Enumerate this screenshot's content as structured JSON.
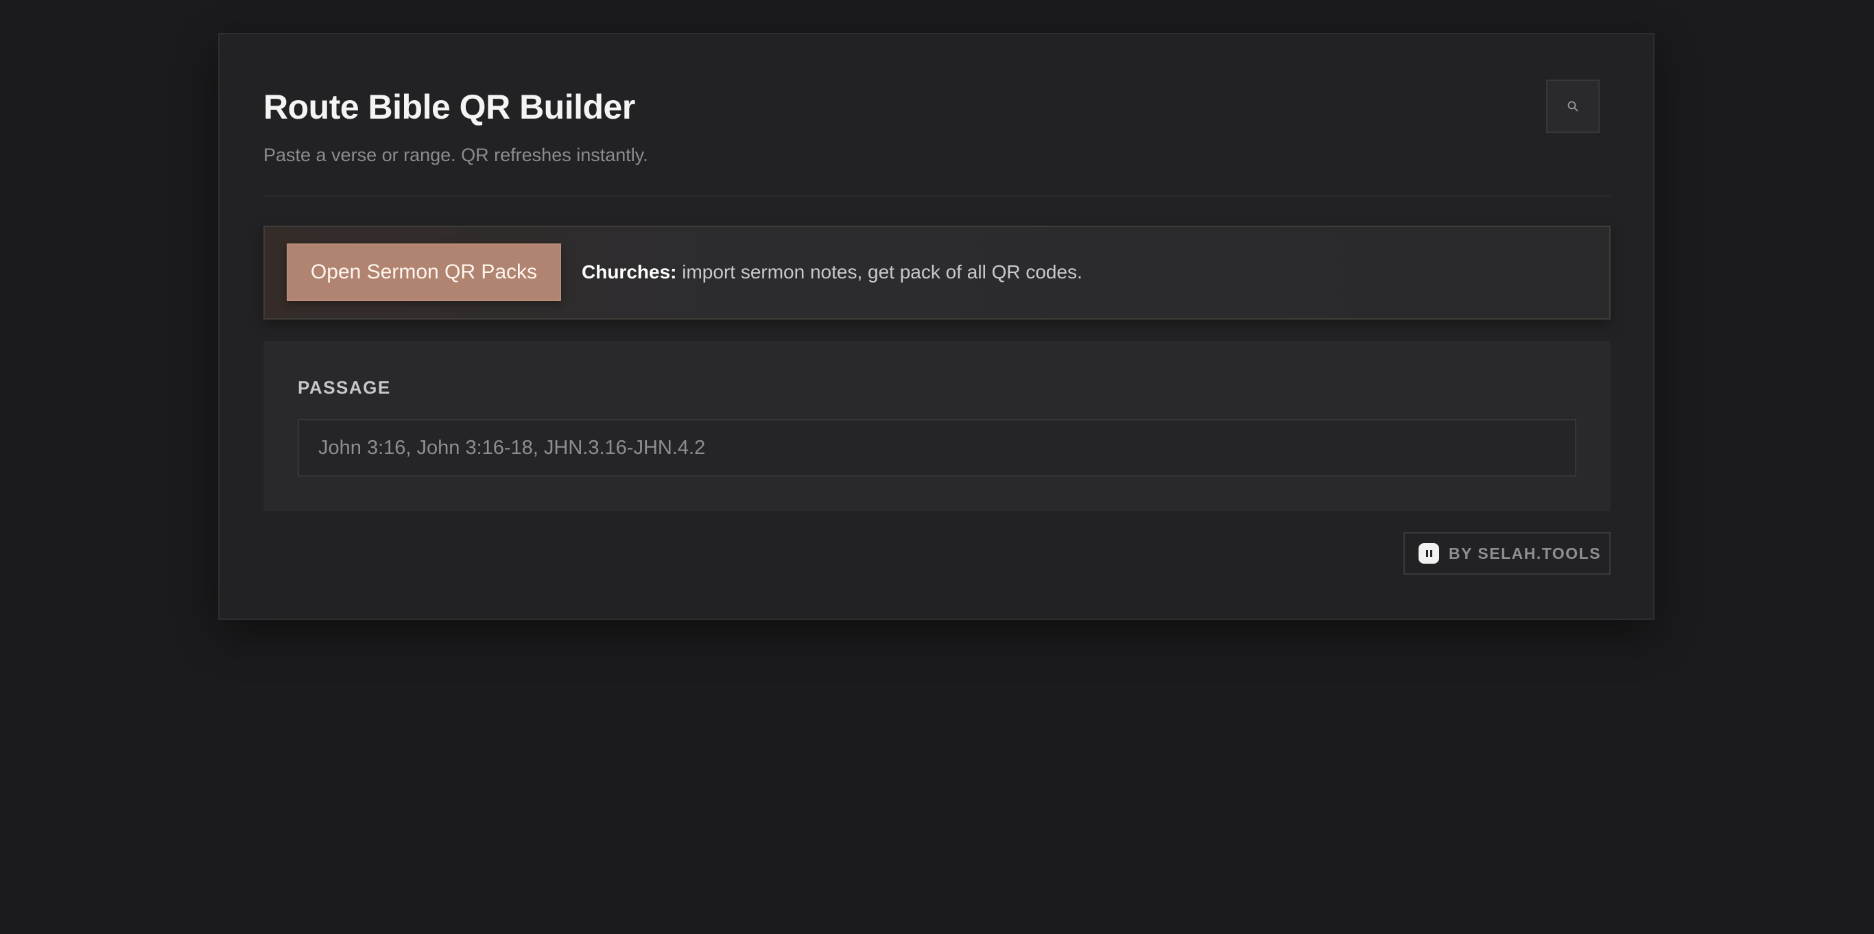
{
  "header": {
    "title": "Route Bible QR Builder",
    "subtitle": "Paste a verse or range. QR refreshes instantly.",
    "search_icon": "search-icon"
  },
  "promo": {
    "button_label": "Open Sermon QR Packs",
    "text_bold": "Churches:",
    "text_rest": " import sermon notes, get pack of all QR codes.",
    "accent_color": "#b08470"
  },
  "passage": {
    "label": "PASSAGE",
    "value": "",
    "placeholder": "John 3:16, John 3:16-18, JHN.3.16-JHN.4.2"
  },
  "footer": {
    "badge_icon": "pause-icon",
    "badge_label": "BY SELAH.TOOLS"
  }
}
